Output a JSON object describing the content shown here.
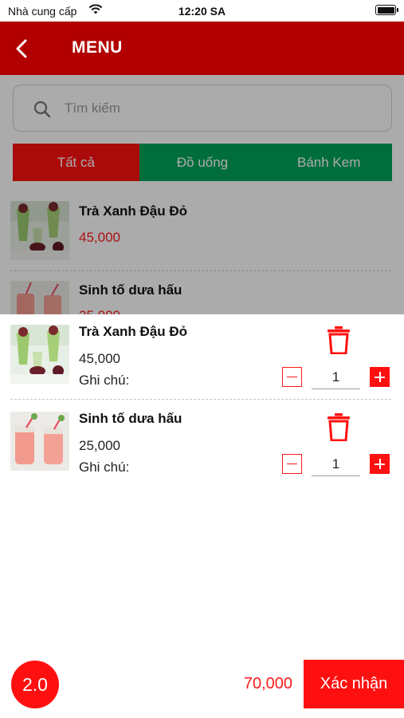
{
  "status_bar": {
    "carrier": "Nhà cung cấp",
    "time": "12:20 SA"
  },
  "nav": {
    "title": "MENU"
  },
  "search": {
    "placeholder": "Tìm kiếm"
  },
  "tabs": [
    {
      "label": "Tất cả",
      "active": true
    },
    {
      "label": "Đồ uống",
      "active": false
    },
    {
      "label": "Bánh Kem",
      "active": false
    }
  ],
  "menu": [
    {
      "name": "Trà Xanh Đậu Đỏ",
      "price": "45,000"
    },
    {
      "name": "Sinh tố dưa hấu",
      "price": "25,000"
    }
  ],
  "cart": {
    "items": [
      {
        "name": "Trà Xanh Đậu Đỏ",
        "price": "45,000",
        "note_label": "Ghi chú:",
        "quantity": "1"
      },
      {
        "name": "Sinh tố dưa hấu",
        "price": "25,000",
        "note_label": "Ghi chú:",
        "quantity": "1"
      }
    ],
    "badge": "2.0",
    "total": "70,000",
    "confirm_label": "Xác nhận"
  },
  "colors": {
    "header": "#b20000",
    "accent": "#ff1010",
    "tab_inactive": "#00a45a"
  }
}
